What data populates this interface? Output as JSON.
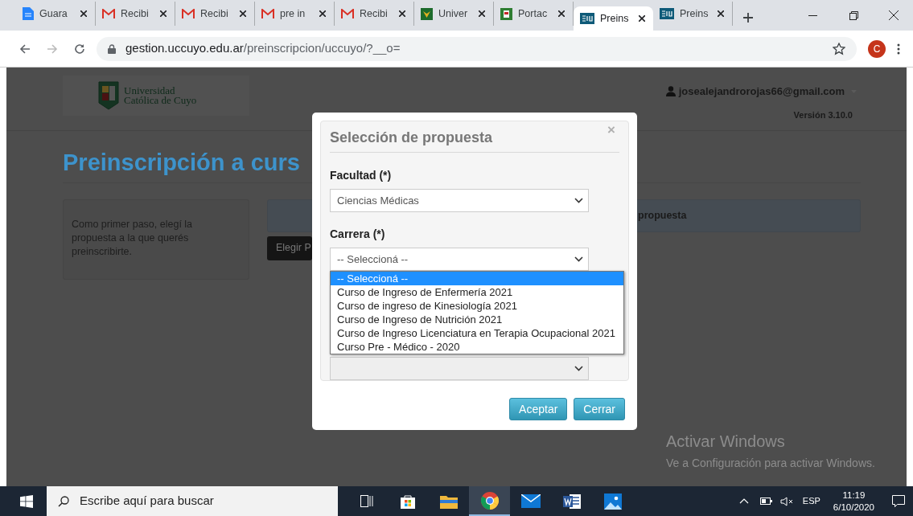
{
  "browser": {
    "tabs": [
      {
        "kind": "docs",
        "title": "Guara",
        "selected": false
      },
      {
        "kind": "gmail",
        "title": "Recibi",
        "selected": false
      },
      {
        "kind": "gmail",
        "title": "Recibi",
        "selected": false
      },
      {
        "kind": "gmail",
        "title": "pre in",
        "selected": false
      },
      {
        "kind": "gmail",
        "title": "Recibi",
        "selected": false
      },
      {
        "kind": "crest",
        "title": "Univer",
        "selected": false
      },
      {
        "kind": "portal",
        "title": "Portac",
        "selected": false
      },
      {
        "kind": "siu",
        "title": "Preins",
        "selected": true
      },
      {
        "kind": "siu",
        "title": "Preins",
        "selected": false
      }
    ],
    "address": {
      "host": "gestion.uccuyo.edu.ar",
      "path": "/preinscripcion/uccuyo/?__o="
    },
    "avatar": "C"
  },
  "page": {
    "logo": {
      "line_1": "Universidad",
      "line_2": "Católica de Cuyo"
    },
    "user": "josealejandrorojas66@gmail.com",
    "version": "Versión 3.10.0",
    "title": "Preinscripción a curs",
    "intro": "Como primer paso, elegí la propuesta a la que querés preinscribirte.",
    "panel_heading": "propuesta",
    "button": "Elegir P"
  },
  "modal": {
    "title": "Selección de propuesta",
    "close": "×",
    "fields": [
      {
        "label": "Facultad (*)",
        "value": "Ciencias Médicas",
        "disabled": false,
        "expanded": false
      },
      {
        "label": "Carrera (*)",
        "value": "-- Seleccioná --",
        "disabled": false,
        "expanded": true
      },
      {
        "disabled": true,
        "expanded": false
      }
    ],
    "options": [
      {
        "label": "-- Seleccioná --",
        "selected": true
      },
      {
        "label": "Curso de Ingreso de Enfermería 2021",
        "selected": false
      },
      {
        "label": "Curso de ingreso de Kinesiología 2021",
        "selected": false
      },
      {
        "label": "Curso de Ingreso de Nutrición 2021",
        "selected": false
      },
      {
        "label": "Curso de Ingreso Licenciatura en Terapia Ocupacional 2021",
        "selected": false
      },
      {
        "label": "Curso Pre - Médico - 2020",
        "selected": false
      }
    ],
    "buttons": [
      "Aceptar",
      "Cerrar"
    ]
  },
  "activation_notice": {
    "title": "Activar Windows",
    "text": "Ve a Configuración para activar Windows."
  },
  "taskbar": {
    "search_placeholder": "Escribe aquí para buscar",
    "apps": [
      {
        "kind": "taskview",
        "active": false
      },
      {
        "kind": "store",
        "active": false
      },
      {
        "kind": "explorer",
        "active": false
      },
      {
        "kind": "chrome",
        "active": true
      },
      {
        "kind": "mail",
        "active": false
      },
      {
        "kind": "word",
        "active": false
      },
      {
        "kind": "photos",
        "active": false
      }
    ],
    "language": "ESP",
    "time": "11:19",
    "date": "6/10/2020"
  }
}
